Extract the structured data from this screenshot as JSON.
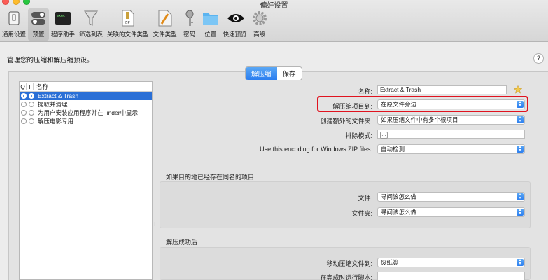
{
  "window": {
    "title": "偏好设置"
  },
  "toolbar": {
    "items": [
      {
        "label": "通用设置",
        "icon": "general-icon"
      },
      {
        "label": "预置",
        "icon": "presets-icon",
        "active": true
      },
      {
        "label": "程序助手",
        "icon": "terminal-icon"
      },
      {
        "label": "筛选列表",
        "icon": "filter-icon"
      },
      {
        "label": "关联的文件类型",
        "icon": "zip-file-icon"
      },
      {
        "label": "文件类型",
        "icon": "file-type-icon"
      },
      {
        "label": "密码",
        "icon": "key-icon"
      },
      {
        "label": "位置",
        "icon": "folder-icon"
      },
      {
        "label": "快速预览",
        "icon": "eye-icon"
      },
      {
        "label": "高级",
        "icon": "gear-icon"
      }
    ]
  },
  "main": {
    "heading": "管理您的压缩和解压缩预设。",
    "help": "?",
    "tabs": [
      {
        "label": "解压缩",
        "active": true
      },
      {
        "label": "保存",
        "active": false
      }
    ]
  },
  "preset_list": {
    "columns": [
      "Q",
      "I",
      "名称"
    ],
    "rows": [
      {
        "name": "Extract & Trash",
        "q": true,
        "i": true,
        "selected": true
      },
      {
        "name": "提取并清理",
        "q": false,
        "i": false,
        "selected": false
      },
      {
        "name": "为用户安装应用程序并在Finder中显示",
        "q": false,
        "i": false,
        "selected": false
      },
      {
        "name": "解压电影专用",
        "q": false,
        "i": false,
        "selected": false
      }
    ]
  },
  "form": {
    "name_label": "名称:",
    "name_value": "Extract & Trash",
    "extract_to_label": "解压缩项目到:",
    "extract_to_value": "在原文件旁边",
    "create_folder_label": "创建额外的文件夹:",
    "create_folder_value": "如果压缩文件中有多个根项目",
    "exclude_label": "排除模式:",
    "exclude_value": "…",
    "encoding_label": "Use this encoding for Windows ZIP files:",
    "encoding_value": "自动检测"
  },
  "existing_section": {
    "title": "如果目的地已经存在同名的项目",
    "file_label": "文件:",
    "file_value": "寻问该怎么做",
    "folder_label": "文件夹:",
    "folder_value": "寻问该怎么做"
  },
  "success_section": {
    "title": "解压成功后",
    "move_label": "移动压缩文件到:",
    "move_value": "废纸篓",
    "script_label": "在完成时运行脚本:"
  },
  "colors": {
    "accent": "#2b7ef0",
    "highlight": "#e0131f",
    "selection": "#2a6fd6"
  }
}
